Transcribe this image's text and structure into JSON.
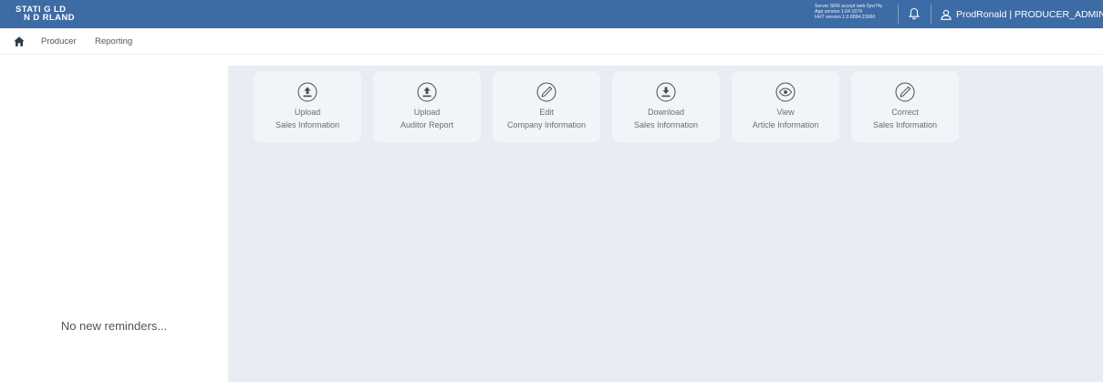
{
  "header": {
    "logo_line1": "STATI G LD",
    "logo_line2": "N D RLAND",
    "server_info": [
      "Server SRN accept web 0yw74y",
      "App version 1.64.1674",
      "HHT version 1.0.8894.23960"
    ],
    "user_label": "ProdRonald | PRODUCER_ADMIN",
    "icons": [
      "bell-icon",
      "user-icon",
      "caret-down-icon"
    ],
    "bg_color": "#3d6ba5"
  },
  "breadcrumb": {
    "items": [
      "Producer",
      "Reporting"
    ]
  },
  "left_panel": {
    "reminders_text": "No new reminders..."
  },
  "tiles": [
    {
      "line1": "Upload",
      "line2": "Sales Information",
      "icon": "upload-icon"
    },
    {
      "line1": "Upload",
      "line2": "Auditor Report",
      "icon": "upload-icon"
    },
    {
      "line1": "Edit",
      "line2": "Company Information",
      "icon": "pencil-icon"
    },
    {
      "line1": "Download",
      "line2": "Sales Information",
      "icon": "download-icon"
    },
    {
      "line1": "View",
      "line2": "Article Information",
      "icon": "eye-icon"
    },
    {
      "line1": "Correct",
      "line2": "Sales Information",
      "icon": "pencil-icon"
    }
  ],
  "colors": {
    "main_bg": "#e7edf2",
    "tile_bg": "#f1f5f9"
  }
}
